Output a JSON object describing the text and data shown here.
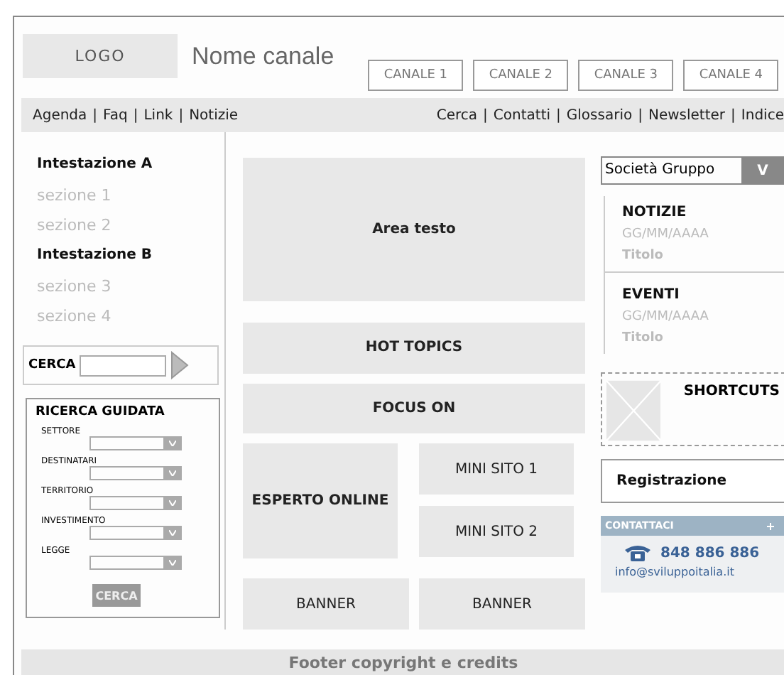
{
  "header": {
    "logo": "LOGO",
    "channel_name": "Nome canale",
    "channels": [
      {
        "label": "CANALE 1"
      },
      {
        "label": "CANALE 2"
      },
      {
        "label": "CANALE 3"
      },
      {
        "label": "CANALE 4"
      }
    ]
  },
  "nav": {
    "separator": "|",
    "left": [
      "Agenda",
      "Faq",
      "Link",
      "Notizie"
    ],
    "right": [
      "Cerca",
      "Contatti",
      "Glossario",
      "Newsletter",
      "Indice"
    ]
  },
  "sidebar": {
    "groups": [
      {
        "heading": "Intestazione A",
        "items": [
          "sezione 1",
          "sezione 2"
        ]
      },
      {
        "heading": "Intestazione B",
        "items": [
          "sezione 3",
          "sezione 4"
        ]
      }
    ],
    "search": {
      "label": "CERCA"
    },
    "guided_search": {
      "title": "RICERCA GUIDATA",
      "fields": [
        "SETTORE",
        "DESTINATARI",
        "TERRITORIO",
        "INVESTIMENTO",
        "LEGGE"
      ],
      "button": "CERCA"
    }
  },
  "main": {
    "area_text": "Area testo",
    "hot_topics": "HOT TOPICS",
    "focus_on": "FOCUS ON",
    "expert": "ESPERTO ONLINE",
    "mini_sites": [
      "MINI SITO 1",
      "MINI SITO 2"
    ],
    "banners": [
      "BANNER",
      "BANNER"
    ]
  },
  "right": {
    "company_select": {
      "value": "Società Gruppo",
      "button": "V"
    },
    "news": [
      {
        "title": "NOTIZIE",
        "date": "GG/MM/AAAA",
        "headline": "Titolo"
      },
      {
        "title": "EVENTI",
        "date": "GG/MM/AAAA",
        "headline": "Titolo"
      }
    ],
    "shortcuts": "SHORTCUTS",
    "registration": "Registrazione",
    "contact": {
      "title": "CONTATTACI",
      "phone": "848 886 886",
      "email": "info@sviluppoitalia.it"
    }
  },
  "footer": "Footer copyright e credits"
}
